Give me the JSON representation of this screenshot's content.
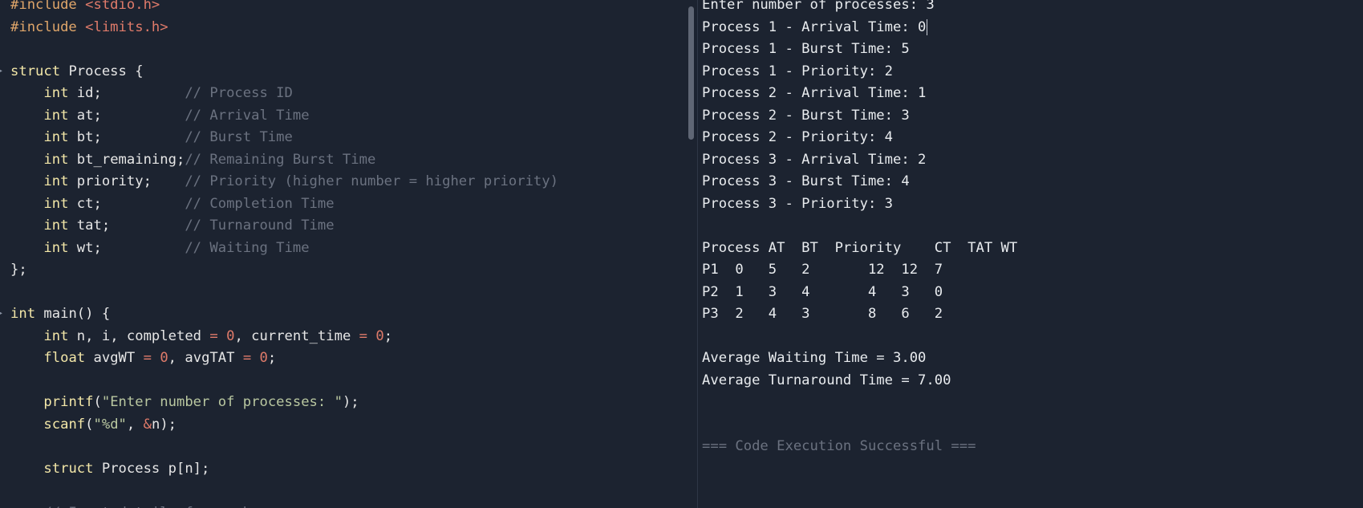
{
  "editor": {
    "lines": [
      [
        [
          "#include ",
          "directive"
        ],
        [
          "<stdio.h>",
          "include"
        ]
      ],
      [
        [
          "#include ",
          "directive"
        ],
        [
          "<limits.h>",
          "include"
        ]
      ],
      [],
      [
        [
          "struct",
          "kw"
        ],
        [
          " Process {",
          "plain"
        ]
      ],
      [
        [
          "    ",
          "plain"
        ],
        [
          "int",
          "kw"
        ],
        [
          " id;          ",
          "plain"
        ],
        [
          "// Process ID",
          "comment"
        ]
      ],
      [
        [
          "    ",
          "plain"
        ],
        [
          "int",
          "kw"
        ],
        [
          " at;          ",
          "plain"
        ],
        [
          "// Arrival Time",
          "comment"
        ]
      ],
      [
        [
          "    ",
          "plain"
        ],
        [
          "int",
          "kw"
        ],
        [
          " bt;          ",
          "plain"
        ],
        [
          "// Burst Time",
          "comment"
        ]
      ],
      [
        [
          "    ",
          "plain"
        ],
        [
          "int",
          "kw"
        ],
        [
          " bt_remaining;",
          "plain"
        ],
        [
          "// Remaining Burst Time",
          "comment"
        ]
      ],
      [
        [
          "    ",
          "plain"
        ],
        [
          "int",
          "kw"
        ],
        [
          " priority;    ",
          "plain"
        ],
        [
          "// Priority (higher number = higher priority)",
          "comment"
        ]
      ],
      [
        [
          "    ",
          "plain"
        ],
        [
          "int",
          "kw"
        ],
        [
          " ct;          ",
          "plain"
        ],
        [
          "// Completion Time",
          "comment"
        ]
      ],
      [
        [
          "    ",
          "plain"
        ],
        [
          "int",
          "kw"
        ],
        [
          " tat;         ",
          "plain"
        ],
        [
          "// Turnaround Time",
          "comment"
        ]
      ],
      [
        [
          "    ",
          "plain"
        ],
        [
          "int",
          "kw"
        ],
        [
          " wt;          ",
          "plain"
        ],
        [
          "// Waiting Time",
          "comment"
        ]
      ],
      [
        [
          "};",
          "plain"
        ]
      ],
      [],
      [
        [
          "int",
          "kw"
        ],
        [
          " main() {",
          "plain"
        ]
      ],
      [
        [
          "    ",
          "plain"
        ],
        [
          "int",
          "kw"
        ],
        [
          " n, i, completed ",
          "plain"
        ],
        [
          "=",
          "op"
        ],
        [
          " ",
          "plain"
        ],
        [
          "0",
          "num"
        ],
        [
          ", current_time ",
          "plain"
        ],
        [
          "=",
          "op"
        ],
        [
          " ",
          "plain"
        ],
        [
          "0",
          "num"
        ],
        [
          ";",
          "plain"
        ]
      ],
      [
        [
          "    ",
          "plain"
        ],
        [
          "float",
          "kw"
        ],
        [
          " avgWT ",
          "plain"
        ],
        [
          "=",
          "op"
        ],
        [
          " ",
          "plain"
        ],
        [
          "0",
          "num"
        ],
        [
          ", avgTAT ",
          "plain"
        ],
        [
          "=",
          "op"
        ],
        [
          " ",
          "plain"
        ],
        [
          "0",
          "num"
        ],
        [
          ";",
          "plain"
        ]
      ],
      [],
      [
        [
          "    ",
          "plain"
        ],
        [
          "printf",
          "kw"
        ],
        [
          "(",
          "plain"
        ],
        [
          "\"Enter number of processes: \"",
          "str"
        ],
        [
          ");",
          "plain"
        ]
      ],
      [
        [
          "    ",
          "plain"
        ],
        [
          "scanf",
          "kw"
        ],
        [
          "(",
          "plain"
        ],
        [
          "\"%d\"",
          "str"
        ],
        [
          ", ",
          "plain"
        ],
        [
          "&",
          "op"
        ],
        [
          "n);",
          "plain"
        ]
      ],
      [],
      [
        [
          "    ",
          "plain"
        ],
        [
          "struct",
          "kw"
        ],
        [
          " Process p[n];",
          "plain"
        ]
      ],
      [],
      [
        [
          "    ",
          "plain"
        ],
        [
          "// Input details for each process",
          "comment"
        ]
      ]
    ],
    "fold_markers": [
      3,
      14
    ]
  },
  "output": {
    "lines": [
      "Enter number of processes: 3",
      "Process 1 - Arrival Time: 0",
      "Process 1 - Burst Time: 5",
      "Process 1 - Priority: 2",
      "Process 2 - Arrival Time: 1",
      "Process 2 - Burst Time: 3",
      "Process 2 - Priority: 4",
      "Process 3 - Arrival Time: 2",
      "Process 3 - Burst Time: 4",
      "Process 3 - Priority: 3",
      "",
      "Process AT  BT  Priority    CT  TAT WT",
      "P1  0   5   2       12  12  7",
      "P2  1   3   4       4   3   0",
      "P3  2   4   3       8   6   2",
      "",
      "Average Waiting Time = 3.00",
      "Average Turnaround Time = 7.00",
      "",
      "",
      "=== Code Execution Successful ==="
    ],
    "muted_line_index": 20,
    "cursor_line_index": 1
  },
  "colors": {
    "background": "#1c2330",
    "keyword": "#f3e7a8",
    "comment": "#6b7280",
    "number": "#e07b6a",
    "string": "#b9c7a0",
    "directive": "#e0a66a"
  }
}
